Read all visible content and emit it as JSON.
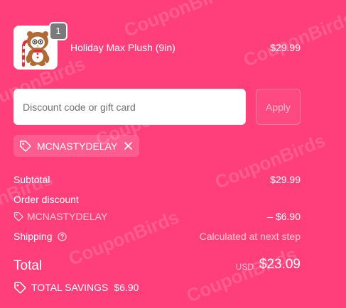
{
  "watermark": {
    "text": "CouponBirds"
  },
  "product": {
    "name": "Holiday Max Plush (9in)",
    "price": "$29.99",
    "quantity": "1",
    "image_icon": "plush-gingerbread-image"
  },
  "discount": {
    "placeholder": "Discount code or gift card",
    "value": "",
    "apply_label": "Apply",
    "applied_code": "MCNASTYDELAY"
  },
  "summary": {
    "subtotal_label": "Subtotal",
    "subtotal_value": "$29.99",
    "order_discount_label": "Order discount",
    "discount_code": "MCNASTYDELAY",
    "discount_value": "– $6.90",
    "shipping_label": "Shipping",
    "shipping_value": "Calculated at next step",
    "total_label": "Total",
    "total_currency": "USD",
    "total_value": "$23.09",
    "savings_label": "TOTAL SAVINGS",
    "savings_value": "$6.90"
  },
  "colors": {
    "background": "#ff3e7c",
    "text": "#ffffff",
    "input_background": "#ffffff",
    "badge": "#7a7a7a"
  }
}
